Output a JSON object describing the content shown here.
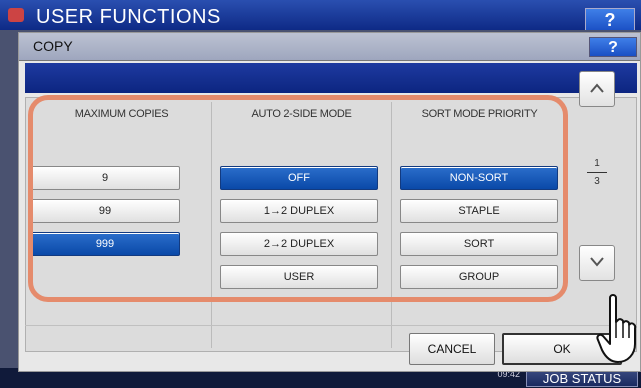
{
  "background": {
    "title": "USER FUNCTIONS",
    "help_label": "?",
    "job_status_label": "JOB STATUS",
    "date": "",
    "time": "09:42"
  },
  "dialog": {
    "title": "COPY",
    "help_label": "?",
    "columns": {
      "copies": {
        "header": "MAXIMUM COPIES",
        "options": [
          "9",
          "99",
          "999"
        ],
        "selected": "999"
      },
      "duplex": {
        "header": "AUTO 2-SIDE MODE",
        "options": [
          "OFF",
          "1→2 DUPLEX",
          "2→2 DUPLEX",
          "USER"
        ],
        "selected": "OFF"
      },
      "sort": {
        "header": "SORT MODE PRIORITY",
        "options": [
          "NON-SORT",
          "STAPLE",
          "SORT",
          "GROUP"
        ],
        "selected": "NON-SORT"
      }
    },
    "pager": {
      "current": "1",
      "total": "3"
    },
    "cancel_label": "CANCEL",
    "ok_label": "OK"
  },
  "colors": {
    "selected_button": "#0a49a8",
    "highlight_outline": "#e58b6c",
    "title_bar": "#1e3aa0"
  },
  "icons": [
    "chevron-up-icon",
    "chevron-down-icon",
    "hand-pointer-icon",
    "help-icon",
    "app-logo-icon"
  ]
}
